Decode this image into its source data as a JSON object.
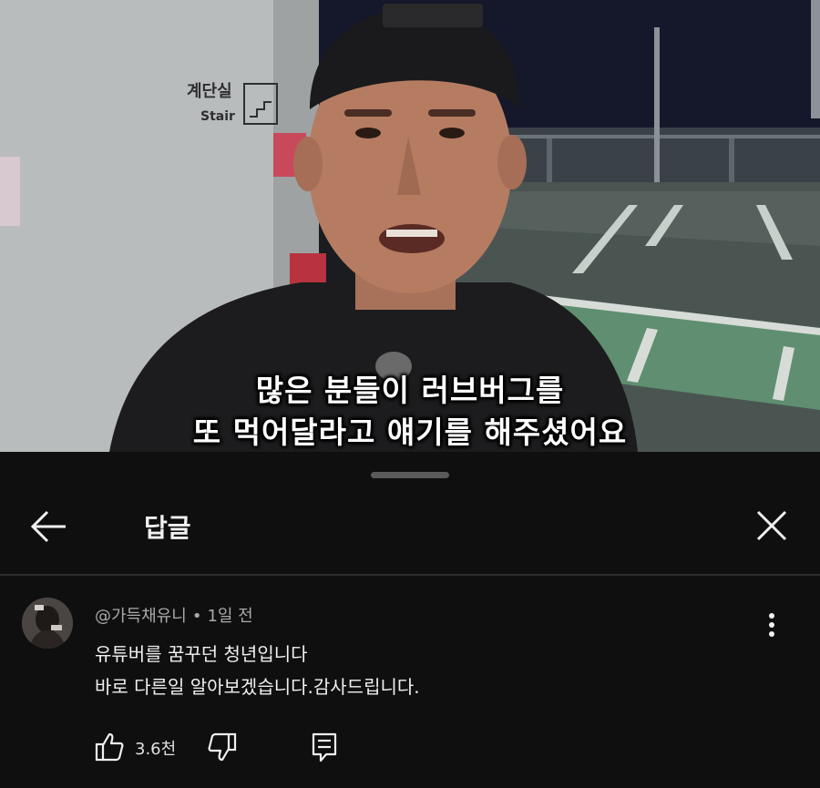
{
  "video": {
    "subtitle_line1": "많은 분들이 러브버그를",
    "subtitle_line2": "또 먹어달라고 얘기를 해주셨어요",
    "wall_sign_korean": "계단실",
    "wall_sign_english": "Stair"
  },
  "panel": {
    "title": "답글",
    "back_icon": "arrow-left-icon",
    "close_icon": "close-icon"
  },
  "comment": {
    "author": "@가득채유니",
    "separator": "•",
    "time": "1일 전",
    "line1": "유튜버를 꿈꾸던 청년입니다",
    "line2": "바로 다른일 알아보겠습니다.감사드립니다.",
    "like_count": "3.6천",
    "icons": [
      "thumbs-up-icon",
      "thumbs-down-icon",
      "reply-icon",
      "more-vert-icon"
    ]
  },
  "colors": {
    "panel_bg": "#0f0f0f",
    "text_primary": "#f1f1f1",
    "text_secondary": "#aaaaaa"
  }
}
